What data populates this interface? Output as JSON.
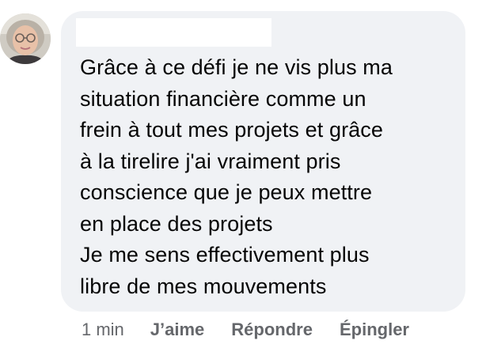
{
  "comment": {
    "author_name": "",
    "avatar": "user-avatar-photo",
    "text": "Grâce à ce défi je ne vis plus ma\nsituation financière comme un\nfrein à tout mes projets et grâce\nà la tirelire j'ai vraiment pris\nconscience que je peux mettre\nen place des projets\nJe me sens effectivement plus\nlibre de mes mouvements",
    "timestamp": "1 min",
    "actions": {
      "like_label": "J’aime",
      "reply_label": "Répondre",
      "pin_label": "Épingler"
    }
  },
  "colors": {
    "bubble_background": "#f0f2f5",
    "text": "#050505",
    "secondary_text": "#65676b"
  }
}
